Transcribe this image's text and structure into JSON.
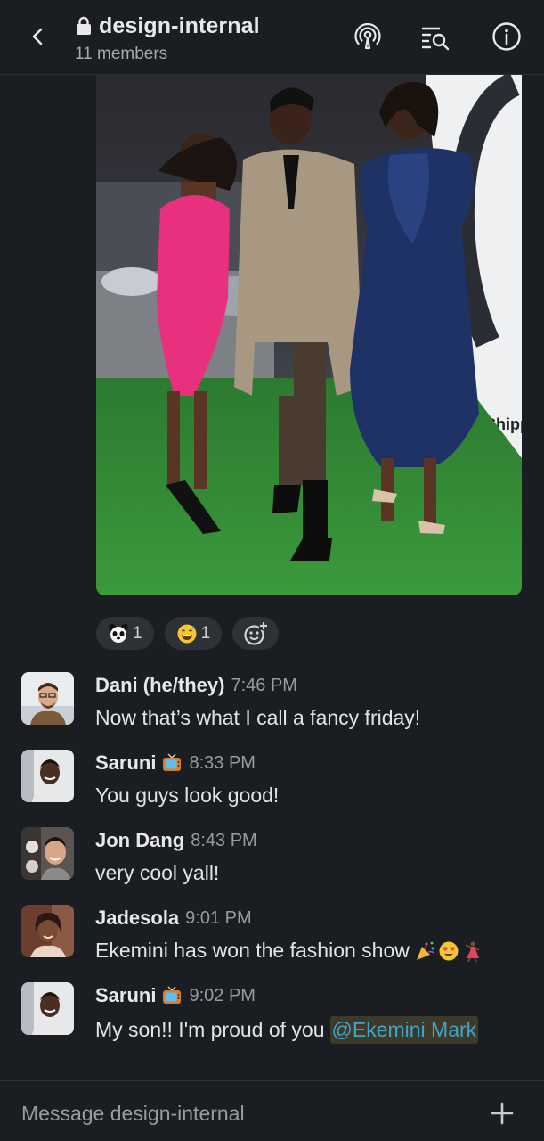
{
  "header": {
    "channel_name": "design-internal",
    "member_count": "11 members"
  },
  "icons": {
    "back": "chevron-left-icon",
    "lock": "lock-icon",
    "huddle": "podcast-icon",
    "search": "search-icon",
    "info": "info-icon",
    "add_reaction": "add-emoji-icon",
    "add": "plus-icon"
  },
  "photo": {
    "banner_text": "Chipp"
  },
  "reactions": [
    {
      "emoji": "panda-face",
      "count": "1"
    },
    {
      "emoji": "grinning-sweat",
      "count": "1"
    }
  ],
  "messages": [
    {
      "sender": "Dani (he/they)",
      "time": "7:46 PM",
      "text": "Now that’s what I call a fancy friday!",
      "status_emoji": ""
    },
    {
      "sender": "Saruni",
      "time": "8:33 PM",
      "text": "You guys look good!",
      "status_emoji": "tv"
    },
    {
      "sender": "Jon Dang",
      "time": "8:43 PM",
      "text": "very cool yall!",
      "status_emoji": ""
    },
    {
      "sender": "Jadesola",
      "time": "9:01 PM",
      "text": "Ekemini has won the fashion show",
      "status_emoji": "",
      "trailing_emojis": [
        "party-popper",
        "heart-eyes",
        "dancer"
      ]
    },
    {
      "sender": "Saruni",
      "time": "9:02 PM",
      "text": "My son!! I'm proud of you",
      "status_emoji": "tv",
      "mention": "@Ekemini Mark"
    }
  ],
  "composer": {
    "placeholder": "Message design-internal"
  },
  "colors": {
    "background": "#1a1d21",
    "pill": "#2e3136",
    "mention_text": "#3ea6ce",
    "mention_bg": "#3d3a2a"
  }
}
